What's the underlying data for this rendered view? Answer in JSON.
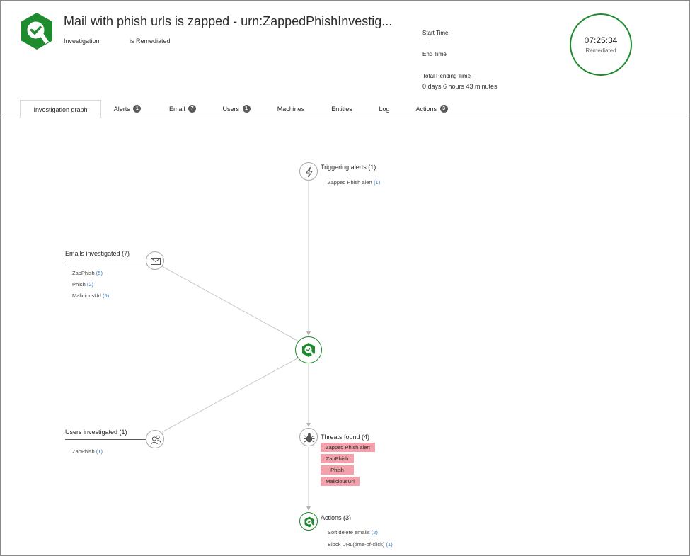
{
  "header": {
    "title": "Mail with phish urls is zapped - urn:ZappedPhishInvestig...",
    "type_label": "Investigation",
    "status_label": "is Remediated",
    "start_time_label": "Start Time",
    "start_time_value": "-",
    "end_time_label": "End Time",
    "pending_label": "Total Pending Time",
    "pending_value": "0 days 6 hours 43 minutes",
    "timer": {
      "time": "07:25:34",
      "status": "Remediated"
    },
    "logo_icon": "investigation-check-icon",
    "accent_color": "#1e8c2e"
  },
  "tabs": [
    {
      "label": "Investigation graph",
      "badge": ""
    },
    {
      "label": "Alerts",
      "badge": "1"
    },
    {
      "label": "Email",
      "badge": "7"
    },
    {
      "label": "Users",
      "badge": "1"
    },
    {
      "label": "Machines",
      "badge": ""
    },
    {
      "label": "Entities",
      "badge": ""
    },
    {
      "label": "Log",
      "badge": ""
    },
    {
      "label": "Actions",
      "badge": "3"
    }
  ],
  "active_tab": "Investigation graph",
  "graph": {
    "triggering": {
      "label": "Triggering alerts (1)",
      "icon": "lightning-icon",
      "items": [
        {
          "name": "Zapped Phish alert",
          "count": "(1)"
        }
      ]
    },
    "emails": {
      "label": "Emails investigated (7)",
      "icon": "envelope-icon",
      "items": [
        {
          "name": "ZapPhish",
          "count": "(5)"
        },
        {
          "name": "Phish",
          "count": "(2)"
        },
        {
          "name": "MaliciousUrl",
          "count": "(5)"
        }
      ]
    },
    "users": {
      "label": "Users investigated (1)",
      "icon": "users-icon",
      "items": [
        {
          "name": "ZapPhish",
          "count": "(1)"
        }
      ]
    },
    "threats": {
      "label": "Threats found (4)",
      "icon": "bug-icon",
      "tag_color": "#f3a1ab",
      "tags": [
        "Zapped Phish alert",
        "ZapPhish",
        "Phish",
        "MaliciousUrl"
      ]
    },
    "actions": {
      "label": "Actions (3)",
      "icon": "investigation-check-icon",
      "items": [
        {
          "name": "Soft delete emails",
          "count": "(2)"
        },
        {
          "name": "Block URL(time-of-click)",
          "count": "(1)"
        }
      ]
    },
    "center_icon": "investigation-check-icon"
  }
}
